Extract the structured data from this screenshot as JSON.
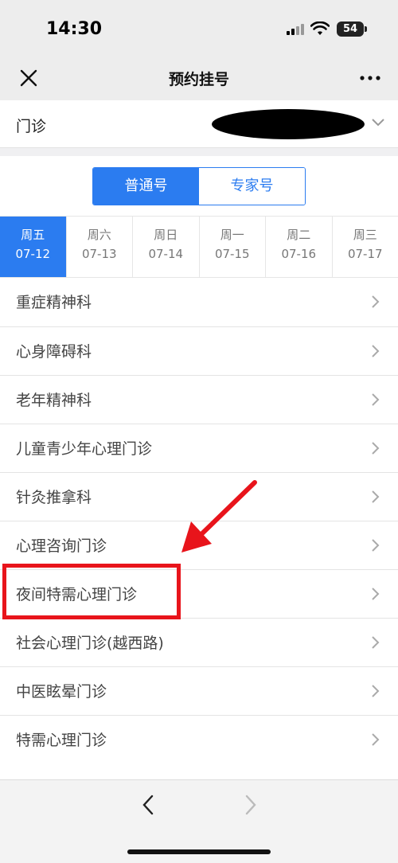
{
  "status_bar": {
    "time": "14:30",
    "battery": "54"
  },
  "nav": {
    "title": "预约挂号",
    "close_icon": "close-icon",
    "more_icon": "more-icon"
  },
  "clinic": {
    "label": "门诊",
    "value_redacted": true
  },
  "registration_type": {
    "options": [
      "普通号",
      "专家号"
    ],
    "selected": "普通号"
  },
  "dates": [
    {
      "weekday": "周五",
      "date": "07-12",
      "active": true
    },
    {
      "weekday": "周六",
      "date": "07-13",
      "active": false
    },
    {
      "weekday": "周日",
      "date": "07-14",
      "active": false
    },
    {
      "weekday": "周一",
      "date": "07-15",
      "active": false
    },
    {
      "weekday": "周二",
      "date": "07-16",
      "active": false
    },
    {
      "weekday": "周三",
      "date": "07-17",
      "active": false
    }
  ],
  "departments": [
    "重症精神科",
    "心身障碍科",
    "老年精神科",
    "儿童青少年心理门诊",
    "针灸推拿科",
    "心理咨询门诊",
    "夜间特需心理门诊",
    "社会心理门诊(越西路)",
    "中医眩晕门诊",
    "特需心理门诊"
  ],
  "highlighted_department": "夜间特需心理门诊",
  "annotation_color": "#e8141b",
  "accent_color": "#2b7cf0"
}
